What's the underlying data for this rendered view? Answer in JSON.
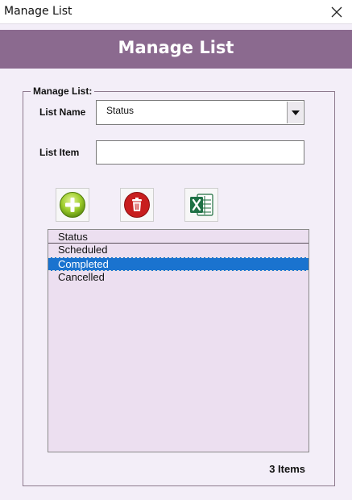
{
  "window": {
    "title": "Manage List"
  },
  "header": {
    "title": "Manage List"
  },
  "form": {
    "group_label": "Manage List:",
    "list_name_label": "List Name",
    "list_name_value": "Status",
    "list_item_label": "List Item",
    "list_item_value": "",
    "toolbar": {
      "add_icon": "plus-circle-green",
      "delete_icon": "trash-red",
      "export_icon": "excel-green"
    },
    "list": {
      "header": "Status",
      "items": [
        "Scheduled",
        "Completed",
        "Cancelled"
      ],
      "selected": "Completed"
    },
    "count_text": "3 Items"
  },
  "colors": {
    "header_bg": "#8b6a8f",
    "body_bg": "#f3eef8",
    "list_bg": "#ecdff0",
    "selection": "#1a73cf"
  }
}
